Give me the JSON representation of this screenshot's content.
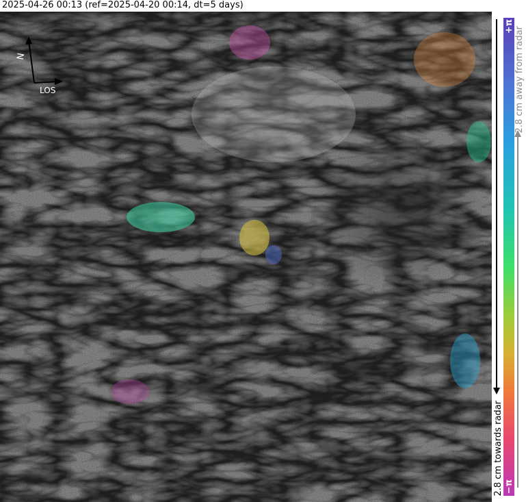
{
  "title": "2025-04-26 00:13 (ref=2025-04-20 00:14, dt=5 days)",
  "compass": {
    "north_label": "N",
    "los_label": "LOS"
  },
  "colorbar": {
    "top_label": "+π",
    "bottom_label": "−π",
    "away_label": "2.8 cm away from radar",
    "towards_label": "2.8 cm towards radar",
    "away_color": "#8c8c8c",
    "towards_color": "#000000"
  }
}
